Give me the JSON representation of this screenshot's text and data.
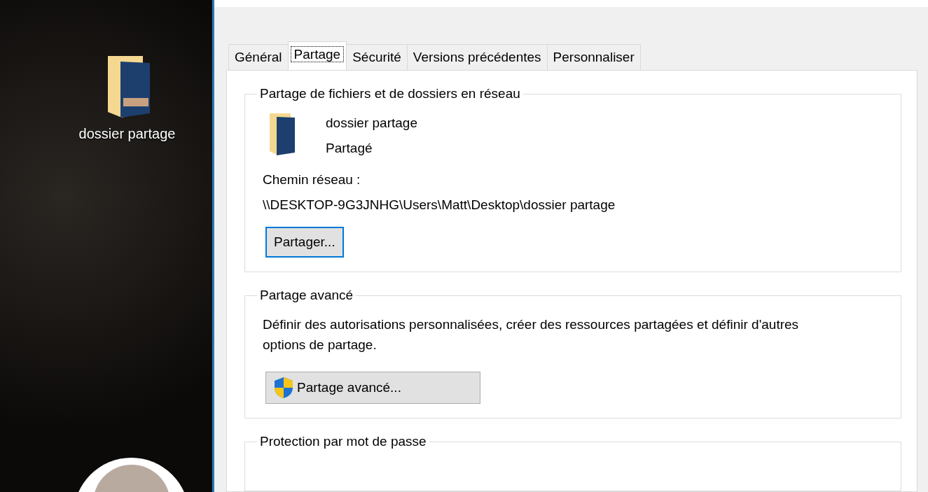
{
  "desktop": {
    "icon_label": "dossier partage"
  },
  "tabs": [
    {
      "label": "Général",
      "selected": false
    },
    {
      "label": "Partage",
      "selected": true
    },
    {
      "label": "Sécurité",
      "selected": false
    },
    {
      "label": "Versions précédentes",
      "selected": false
    },
    {
      "label": "Personnaliser",
      "selected": false
    }
  ],
  "network_sharing": {
    "legend": "Partage de fichiers et de dossiers en réseau",
    "folder_name": "dossier partage",
    "status": "Partagé",
    "path_label": "Chemin réseau :",
    "path": "\\\\DESKTOP-9G3JNHG\\Users\\Matt\\Desktop\\dossier partage",
    "button": "Partager..."
  },
  "advanced_sharing": {
    "legend": "Partage avancé",
    "description": "Définir des autorisations personnalisées, créer des ressources partagées et définir d'autres options de partage.",
    "button": "Partage avancé..."
  },
  "password_protection": {
    "legend": "Protection par mot de passe"
  }
}
